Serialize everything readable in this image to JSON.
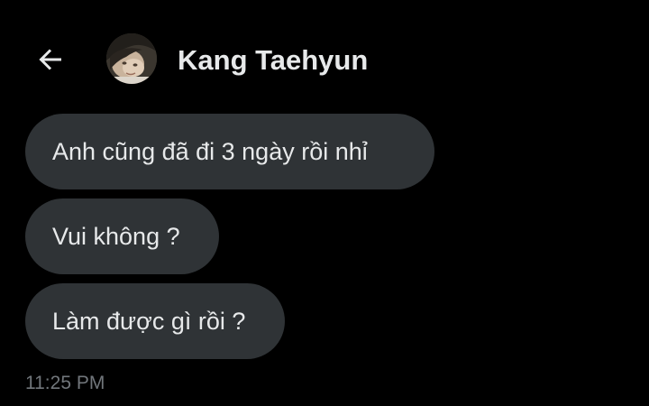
{
  "header": {
    "back_icon": "arrow-left-icon",
    "avatar_icon": "user-avatar",
    "contact_name": "Kang Taehyun"
  },
  "messages": [
    {
      "text": "Anh cũng đã đi 3 ngày rồi nhỉ"
    },
    {
      "text": "Vui không ?"
    },
    {
      "text": "Làm được gì rồi ?"
    }
  ],
  "timestamp": "11:25 PM",
  "colors": {
    "background": "#000000",
    "bubble": "#2f3336",
    "text": "#e7e9ea",
    "muted": "#71767b"
  }
}
